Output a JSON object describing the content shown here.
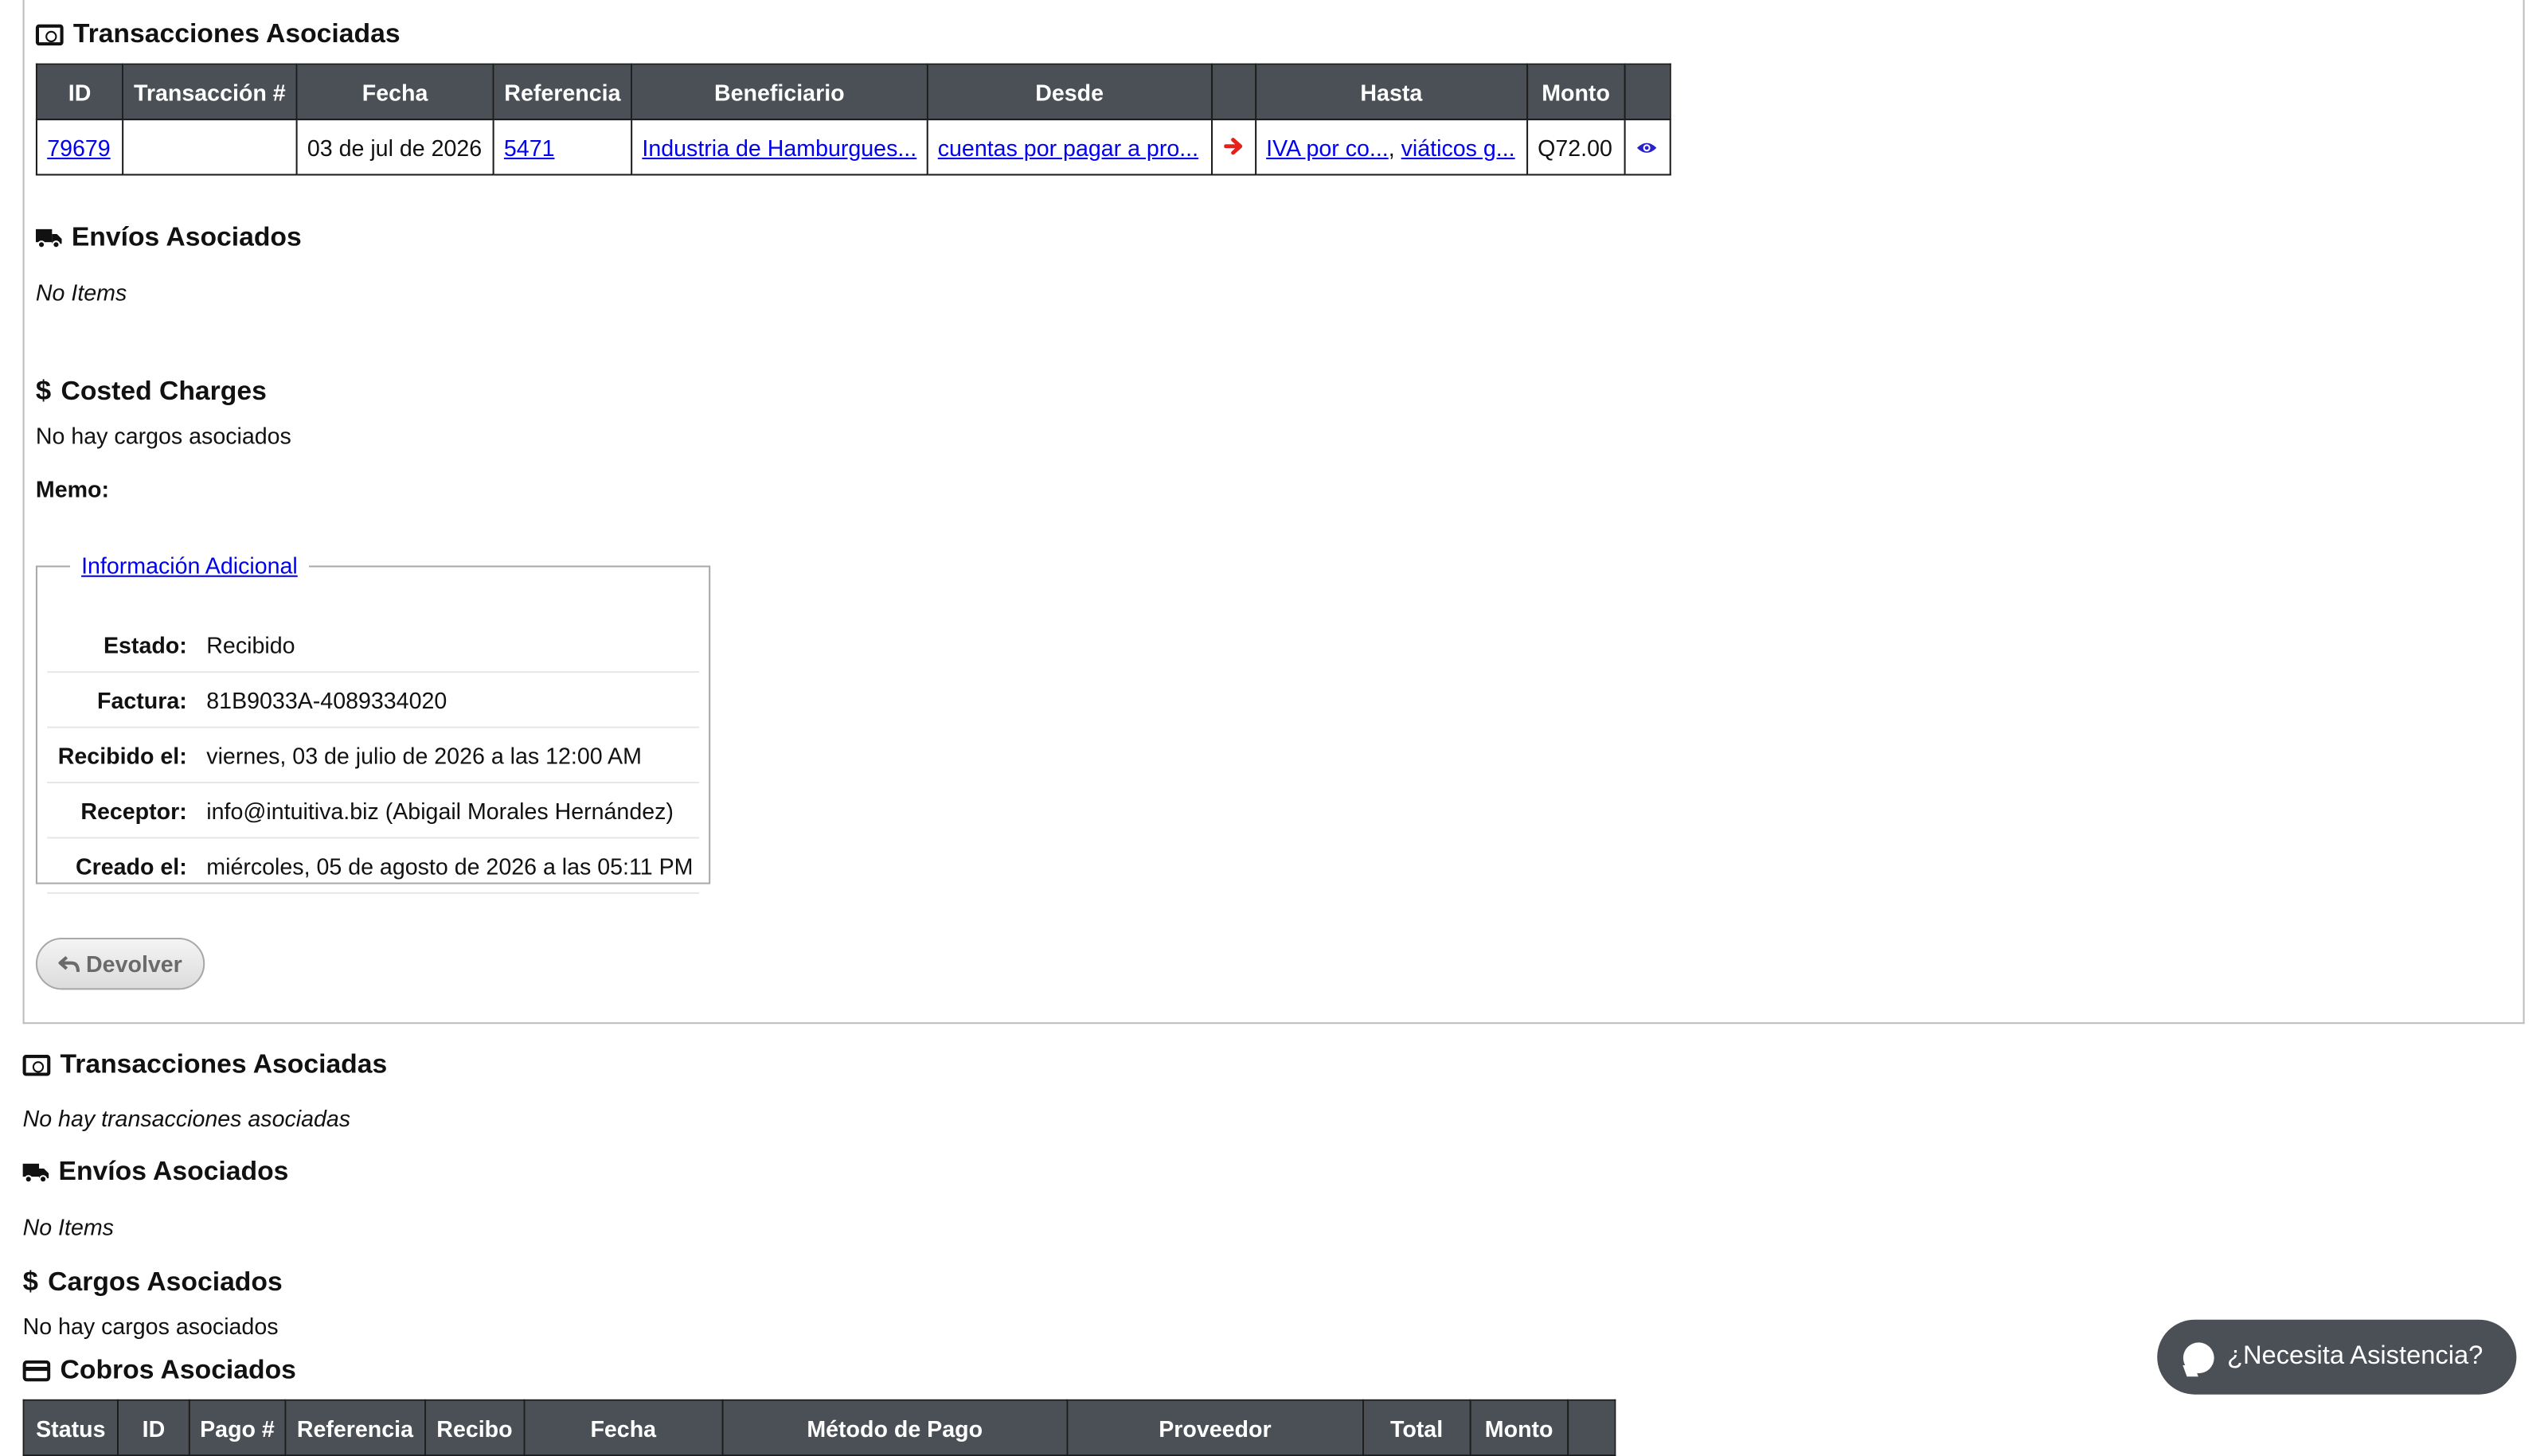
{
  "order_section": {
    "transactions_heading": "Transacciones Asociadas",
    "transactions_table": {
      "headers": [
        "ID",
        "Transacción #",
        "Fecha",
        "Referencia",
        "Beneficiario",
        "Desde",
        "",
        "Hasta",
        "Monto",
        ""
      ],
      "rows": [
        {
          "id": "79679",
          "transaction_no": "",
          "date": "03 de jul de 2026",
          "reference": "5471",
          "beneficiary": "Industria de Hamburgues...",
          "from": "cuentas por pagar a pro...",
          "to_1": "IVA por co...",
          "to_sep": ",",
          "to_2": "viáticos g...",
          "amount": "Q72.00"
        }
      ]
    },
    "shipments_heading": "Envíos Asociados",
    "shipments_empty": "No Items",
    "costed_heading": "Costed Charges",
    "costed_empty": "No hay cargos asociados",
    "memo_label": "Memo:",
    "info_legend": "Información Adicional",
    "info": [
      {
        "label": "Estado:",
        "value": "Recibido"
      },
      {
        "label": "Factura:",
        "value": "81B9033A-4089334020"
      },
      {
        "label": "Recibido el:",
        "value": "viernes, 03 de julio de 2026 a las 12:00 AM"
      },
      {
        "label": "Receptor:",
        "value": "info@intuitiva.biz (Abigail Morales Hernández)"
      },
      {
        "label": "Creado el:",
        "value": "miércoles, 05 de agosto de 2026 a las 05:11 PM"
      }
    ],
    "return_button": "Devolver"
  },
  "page_section": {
    "transactions_heading": "Transacciones Asociadas",
    "transactions_empty": "No hay transacciones asociadas",
    "shipments_heading": "Envíos Asociados",
    "shipments_empty": "No Items",
    "charges_heading": "Cargos Asociados",
    "charges_empty": "No hay cargos asociados",
    "collections_heading": "Cobros Asociados",
    "collections_table": {
      "headers": [
        "Status",
        "ID",
        "Pago #",
        "Referencia",
        "Recibo",
        "Fecha",
        "Método de Pago",
        "Proveedor",
        "Total",
        "Monto",
        ""
      ]
    }
  },
  "chat": {
    "label": "¿Necesita Asistencia?"
  },
  "colors": {
    "header_bg": "#4a5055",
    "link": "#0000ee",
    "arrow": "#e8201a"
  }
}
